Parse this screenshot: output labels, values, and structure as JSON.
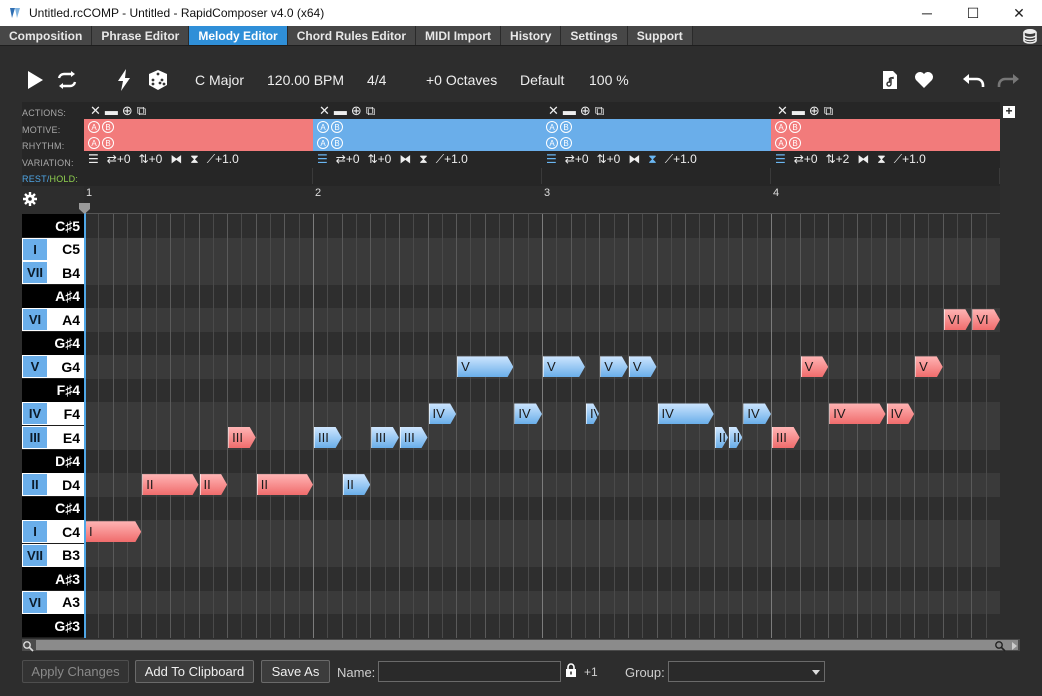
{
  "window": {
    "title": "Untitled.rcCOMP - Untitled - RapidComposer v4.0 (x64)",
    "minimize": "─",
    "maximize": "☐",
    "close": "✕"
  },
  "menu": {
    "tabs": [
      {
        "label": "Composition"
      },
      {
        "label": "Phrase Editor"
      },
      {
        "label": "Melody Editor",
        "active": true
      },
      {
        "label": "Chord Rules Editor"
      },
      {
        "label": "MIDI Import"
      },
      {
        "label": "History"
      },
      {
        "label": "Settings"
      },
      {
        "label": "Support"
      }
    ]
  },
  "toolbar": {
    "key": "C Major",
    "tempo": "120.00 BPM",
    "time_signature": "4/4",
    "octaves": "+0 Octaves",
    "preset": "Default",
    "zoom": "100 %"
  },
  "tracks": {
    "labels": {
      "actions": "ACTIONS:",
      "motive": "MOTIVE:",
      "rhythm": "RHYTHM:",
      "variation": "VARIATION:",
      "rest": "REST",
      "slash": "/",
      "hold": "HOLD:"
    },
    "segments": [
      {
        "color": "red",
        "shift": "+0",
        "transpose": "+0",
        "rate": "+1.0"
      },
      {
        "color": "blue",
        "shift": "+0",
        "transpose": "+0",
        "rate": "+1.0"
      },
      {
        "color": "blue",
        "shift": "+0",
        "transpose": "+0",
        "rate": "+1.0"
      },
      {
        "color": "red",
        "shift": "+0",
        "transpose": "+2",
        "rate": "+1.0"
      }
    ],
    "motive_letters": [
      "A",
      "B"
    ],
    "add_label": "+"
  },
  "ruler": {
    "bars": [
      "1",
      "2",
      "3",
      "4"
    ]
  },
  "keys": [
    {
      "name": "C♯5",
      "degree": "",
      "black": true
    },
    {
      "name": "C5",
      "degree": "I",
      "black": false
    },
    {
      "name": "B4",
      "degree": "VII",
      "black": false
    },
    {
      "name": "A♯4",
      "degree": "",
      "black": true
    },
    {
      "name": "A4",
      "degree": "VI",
      "black": false
    },
    {
      "name": "G♯4",
      "degree": "",
      "black": true
    },
    {
      "name": "G4",
      "degree": "V",
      "black": false
    },
    {
      "name": "F♯4",
      "degree": "",
      "black": true
    },
    {
      "name": "F4",
      "degree": "IV",
      "black": false
    },
    {
      "name": "E4",
      "degree": "III",
      "black": false
    },
    {
      "name": "D♯4",
      "degree": "",
      "black": true
    },
    {
      "name": "D4",
      "degree": "II",
      "black": false
    },
    {
      "name": "C♯4",
      "degree": "",
      "black": true
    },
    {
      "name": "C4",
      "degree": "I",
      "black": false
    },
    {
      "name": "B3",
      "degree": "VII",
      "black": false
    },
    {
      "name": "A♯3",
      "degree": "",
      "black": true
    },
    {
      "name": "A3",
      "degree": "VI",
      "black": false
    },
    {
      "name": "G♯3",
      "degree": "",
      "black": true
    }
  ],
  "notes": [
    {
      "label": "I",
      "row": 13,
      "start": 0,
      "len": 2,
      "color": "red"
    },
    {
      "label": "II",
      "row": 11,
      "start": 2,
      "len": 2,
      "color": "red"
    },
    {
      "label": "II",
      "row": 11,
      "start": 4,
      "len": 1,
      "color": "red"
    },
    {
      "label": "III",
      "row": 9,
      "start": 5,
      "len": 1,
      "color": "red"
    },
    {
      "label": "II",
      "row": 11,
      "start": 6,
      "len": 2,
      "color": "red"
    },
    {
      "label": "III",
      "row": 9,
      "start": 8,
      "len": 1,
      "color": "blue"
    },
    {
      "label": "II",
      "row": 11,
      "start": 9,
      "len": 1,
      "color": "blue"
    },
    {
      "label": "III",
      "row": 9,
      "start": 10,
      "len": 1,
      "color": "blue"
    },
    {
      "label": "III",
      "row": 9,
      "start": 11,
      "len": 1,
      "color": "blue"
    },
    {
      "label": "IV",
      "row": 8,
      "start": 12,
      "len": 1,
      "color": "blue"
    },
    {
      "label": "V",
      "row": 6,
      "start": 13,
      "len": 2,
      "color": "blue"
    },
    {
      "label": "IV",
      "row": 8,
      "start": 15,
      "len": 1,
      "color": "blue"
    },
    {
      "label": "V",
      "row": 6,
      "start": 16,
      "len": 1.5,
      "color": "blue"
    },
    {
      "label": "IV",
      "row": 8,
      "start": 17.5,
      "len": 0.5,
      "color": "blue"
    },
    {
      "label": "V",
      "row": 6,
      "start": 18,
      "len": 1,
      "color": "blue"
    },
    {
      "label": "V",
      "row": 6,
      "start": 19,
      "len": 1,
      "color": "blue"
    },
    {
      "label": "IV",
      "row": 8,
      "start": 20,
      "len": 2,
      "color": "blue"
    },
    {
      "label": "II",
      "row": 9,
      "start": 22,
      "len": 0.5,
      "color": "blue"
    },
    {
      "label": "II",
      "row": 9,
      "start": 22.5,
      "len": 0.5,
      "color": "blue"
    },
    {
      "label": "IV",
      "row": 8,
      "start": 23,
      "len": 1,
      "color": "blue"
    },
    {
      "label": "III",
      "row": 9,
      "start": 24,
      "len": 1,
      "color": "red"
    },
    {
      "label": "V",
      "row": 6,
      "start": 25,
      "len": 1,
      "color": "red"
    },
    {
      "label": "IV",
      "row": 8,
      "start": 26,
      "len": 2,
      "color": "red"
    },
    {
      "label": "IV",
      "row": 8,
      "start": 28,
      "len": 1,
      "color": "red"
    },
    {
      "label": "V",
      "row": 6,
      "start": 29,
      "len": 1,
      "color": "red"
    },
    {
      "label": "VI",
      "row": 4,
      "start": 30,
      "len": 1,
      "color": "red"
    },
    {
      "label": "VI",
      "row": 4,
      "start": 31,
      "len": 1,
      "color": "red"
    }
  ],
  "bottom": {
    "apply": "Apply Changes",
    "clipboard": "Add To Clipboard",
    "save_as": "Save As",
    "name_label": "Name:",
    "name_value": "",
    "lock_count": "+1",
    "group_label": "Group:",
    "group_value": ""
  },
  "colors": {
    "accent": "#2f8fd8",
    "motive_red": "#f27b7b",
    "motive_blue": "#6aaeea"
  }
}
